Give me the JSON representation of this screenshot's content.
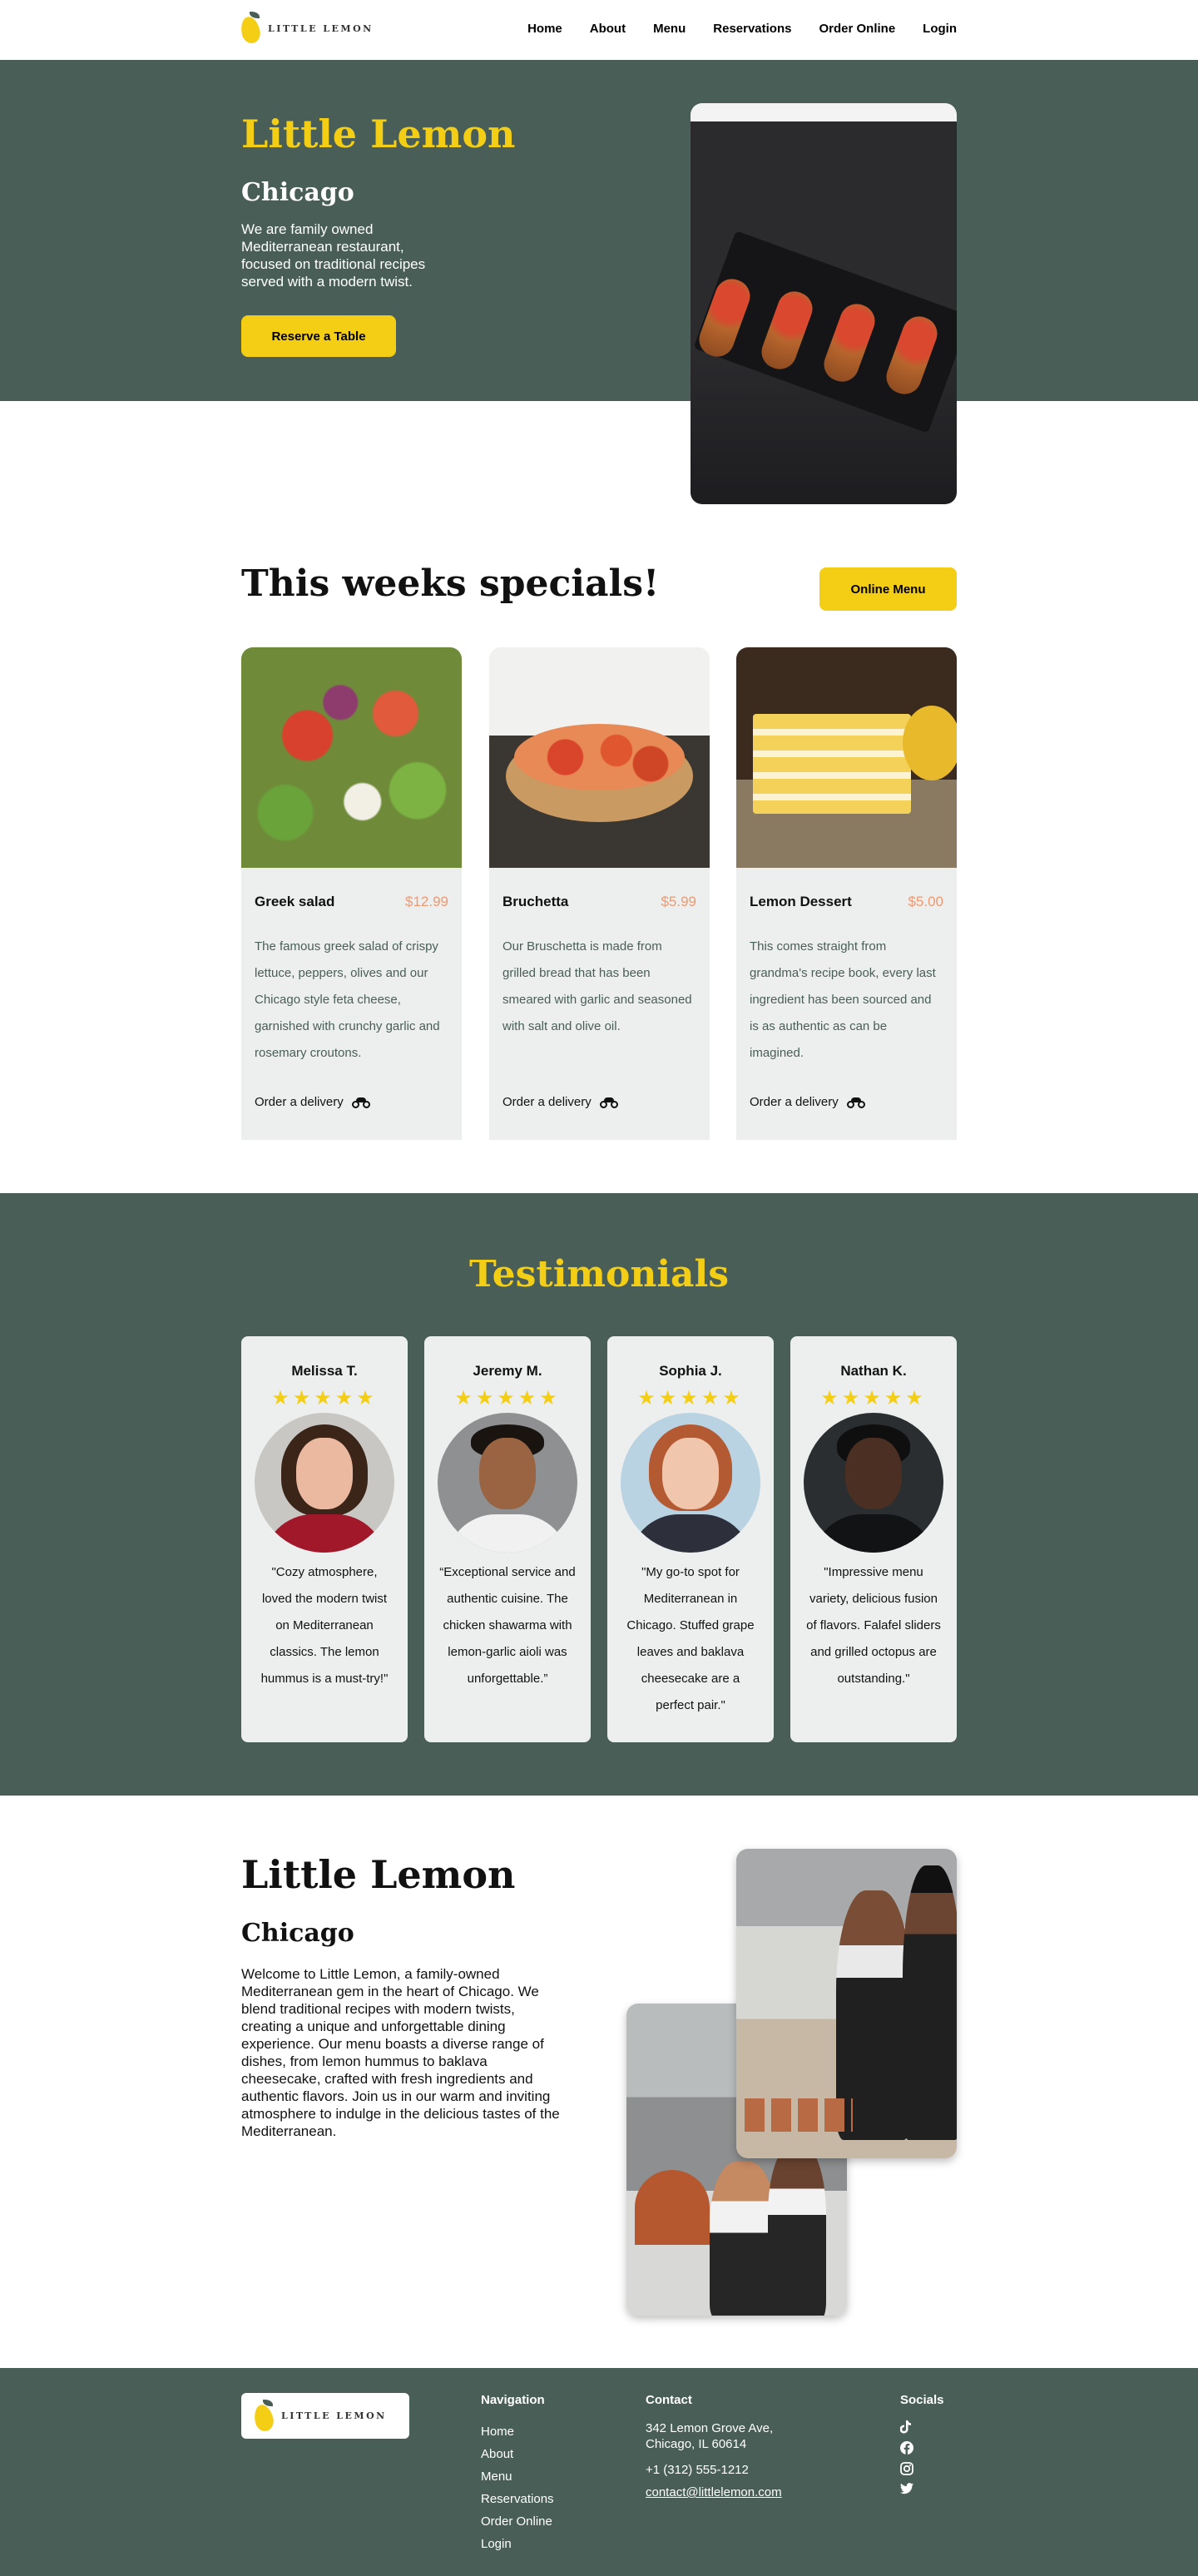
{
  "nav": {
    "logo_text": "LITTLE LEMON",
    "links": [
      "Home",
      "About",
      "Menu",
      "Reservations",
      "Order Online",
      "Login"
    ]
  },
  "hero": {
    "title": "Little Lemon",
    "city": "Chicago",
    "description": "We are family owned Mediterranean restaurant, focused on traditional recipes served with a modern twist.",
    "button": "Reserve a Table"
  },
  "specials": {
    "title": "This weeks specials!",
    "button": "Online Menu",
    "order_label": "Order a delivery",
    "items": [
      {
        "name": "Greek salad",
        "price": "$12.99",
        "description": "The famous greek salad of crispy lettuce, peppers, olives and our Chicago style feta cheese, garnished with crunchy garlic and rosemary croutons."
      },
      {
        "name": "Bruchetta",
        "price": "$5.99",
        "description": "Our Bruschetta is made from grilled bread that has been smeared with garlic and seasoned with salt and olive oil."
      },
      {
        "name": "Lemon Dessert",
        "price": "$5.00",
        "description": "This comes straight from grandma's recipe book, every last ingredient has been sourced and is as authentic as can be imagined."
      }
    ]
  },
  "testimonials": {
    "title": "Testimonials",
    "stars": "★★★★★",
    "items": [
      {
        "name": "Melissa T.",
        "quote": "\"Cozy atmosphere, loved the modern twist on Mediterranean classics. The lemon hummus is a must-try!\""
      },
      {
        "name": "Jeremy M.",
        "quote": "“Exceptional service and authentic cuisine. The chicken shawarma with lemon-garlic aioli was unforgettable.”"
      },
      {
        "name": "Sophia J.",
        "quote": "\"My go-to spot for Mediterranean in Chicago. Stuffed grape leaves and baklava cheesecake are a perfect pair.\""
      },
      {
        "name": "Nathan K.",
        "quote": "\"Impressive menu variety, delicious fusion of flavors. Falafel sliders and grilled octopus are outstanding.\""
      }
    ]
  },
  "about": {
    "title": "Little Lemon",
    "city": "Chicago",
    "description": "Welcome to Little Lemon, a family-owned Mediterranean gem in the heart of Chicago. We blend traditional recipes with modern twists, creating a unique and unforgettable dining experience. Our menu boasts a diverse range of dishes, from lemon hummus to baklava cheesecake, crafted with fresh ingredients and authentic flavors. Join us in our warm and inviting atmosphere to indulge in the delicious tastes of the Mediterranean."
  },
  "footer": {
    "logo_text": "LITTLE LEMON",
    "nav_heading": "Navigation",
    "nav_links": [
      "Home",
      "About",
      "Menu",
      "Reservations",
      "Order Online",
      "Login"
    ],
    "contact_heading": "Contact",
    "address": "342 Lemon Grove Ave, Chicago, IL 60614",
    "phone": "+1 (312) 555-1212",
    "email": "contact@littlelemon.com",
    "socials_heading": "Socials",
    "socials": [
      "tiktok-icon",
      "facebook-icon",
      "instagram-icon",
      "twitter-icon"
    ]
  },
  "colors": {
    "primary_green": "#495E57",
    "primary_yellow": "#F4CE14",
    "accent_salmon": "#EE9972",
    "card_bg": "#EDEFEE"
  }
}
